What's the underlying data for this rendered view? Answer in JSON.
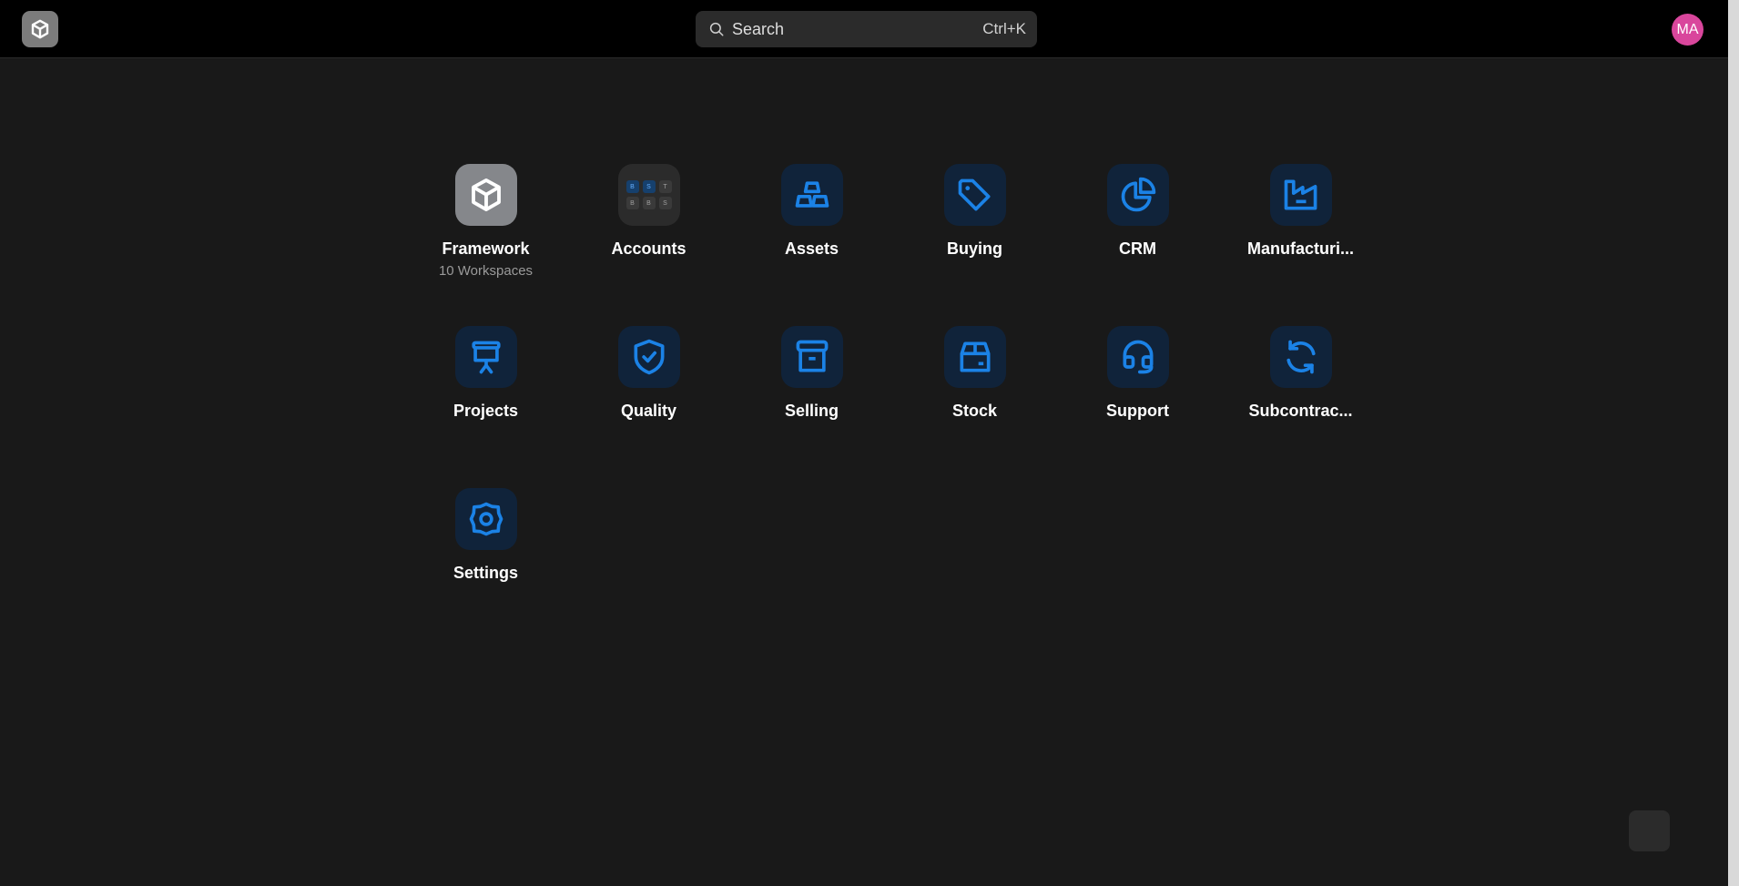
{
  "colors": {
    "background": "#191919",
    "topbar": "#000000",
    "accent": "#1b82e6",
    "tile": "#10233a",
    "avatar": "#d9469c"
  },
  "topbar": {
    "logo_icon": "cube-icon",
    "search": {
      "label": "Search",
      "shortcut": "Ctrl+K"
    },
    "avatar": "MA"
  },
  "apps": [
    {
      "label": "Framework",
      "sub": "10 Workspaces",
      "icon": "cube-icon"
    },
    {
      "label": "Accounts",
      "icon": "workspace-grid-icon",
      "mini": [
        "B",
        "S",
        "T",
        "B",
        "B",
        "S"
      ]
    },
    {
      "label": "Assets",
      "icon": "bricks-icon"
    },
    {
      "label": "Buying",
      "icon": "tag-icon"
    },
    {
      "label": "CRM",
      "icon": "pie-chart-icon"
    },
    {
      "label": "Manufacturi...",
      "icon": "factory-icon"
    },
    {
      "label": "Projects",
      "icon": "presentation-board-icon"
    },
    {
      "label": "Quality",
      "icon": "shield-check-icon"
    },
    {
      "label": "Selling",
      "icon": "storefront-icon"
    },
    {
      "label": "Stock",
      "icon": "box-icon"
    },
    {
      "label": "Support",
      "icon": "headset-icon"
    },
    {
      "label": "Subcontrac...",
      "icon": "refresh-icon"
    },
    {
      "label": "Settings",
      "icon": "gear-icon"
    }
  ]
}
